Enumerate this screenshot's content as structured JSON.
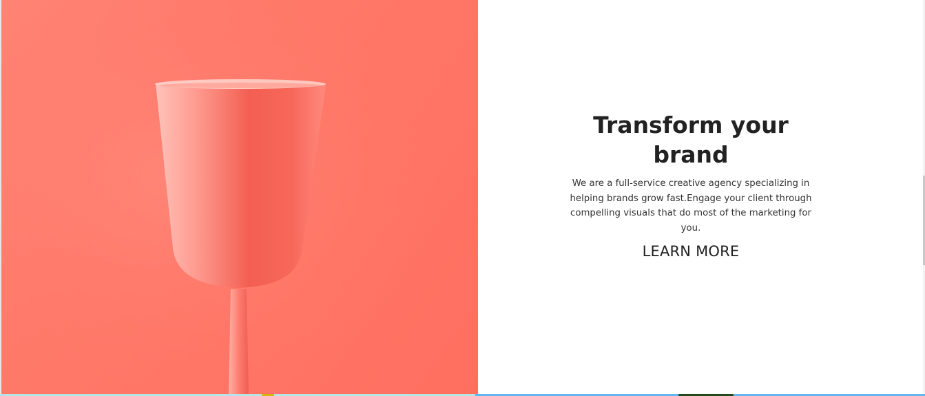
{
  "hero": {
    "title": "Transform your brand",
    "description": "We are a full-service creative agency specializing in helping brands grow fast.Engage your client through compelling visuals that do most of the marketing for you.",
    "cta_label": "LEARN MORE"
  },
  "image": {
    "subject": "pink-wine-glass-icon",
    "background_color": "#ff7565",
    "glass_color": "#ff8a80"
  },
  "colors": {
    "text": "#222222",
    "panel_background": "#ffffff",
    "bottom_strip_left": "#b8e4e4",
    "bottom_strip_right": "#63b7ee"
  }
}
